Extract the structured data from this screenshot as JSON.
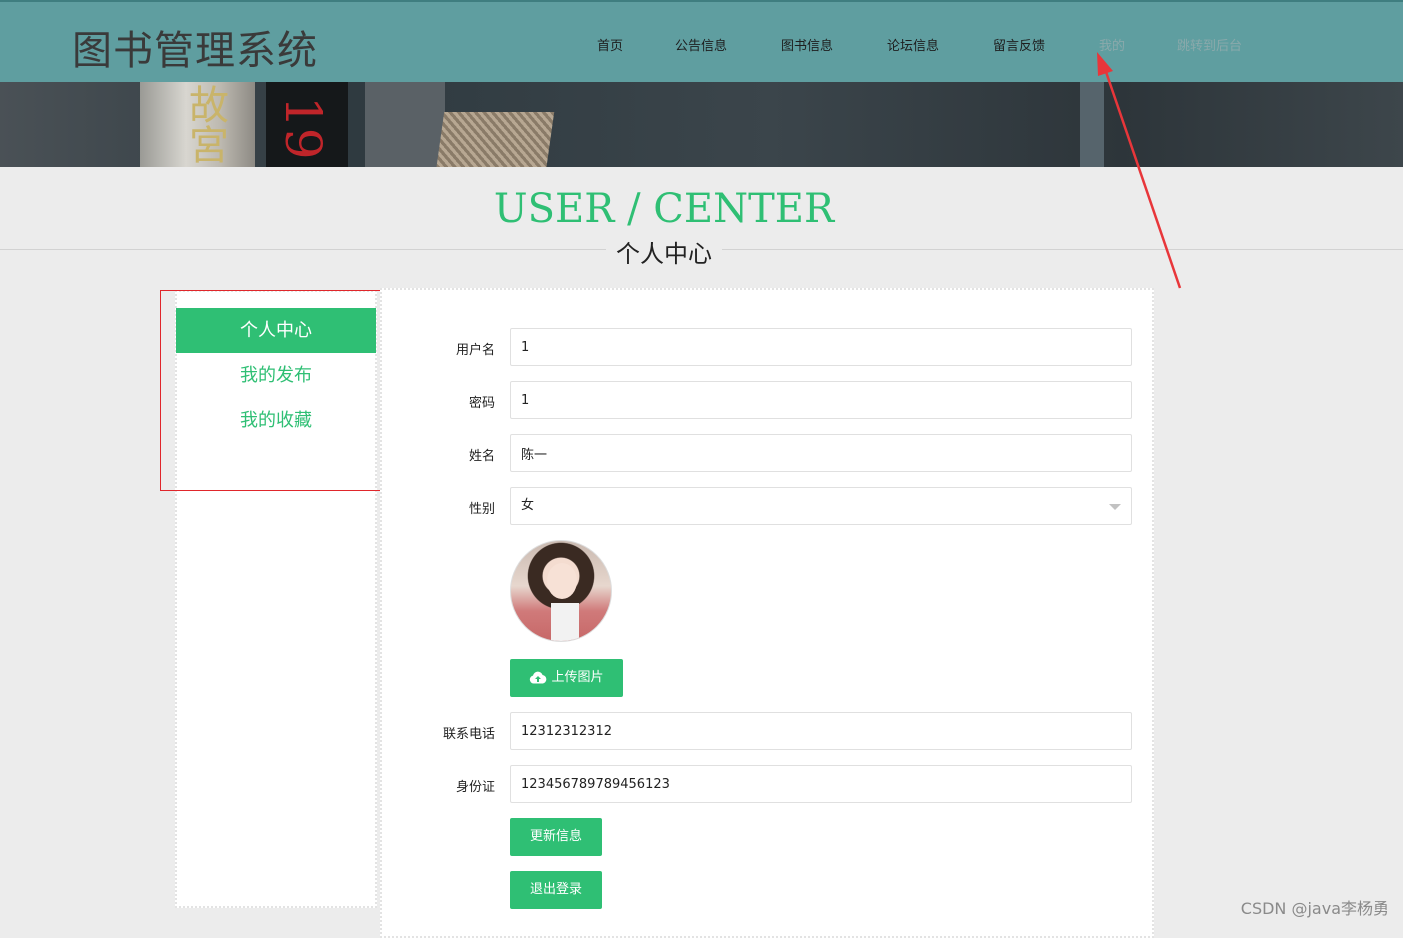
{
  "header": {
    "logo": "图书管理系统",
    "nav": [
      "首页",
      "公告信息",
      "图书信息",
      "论坛信息",
      "留言反馈",
      "我的",
      "跳转到后台"
    ]
  },
  "banner": {
    "book_text_1": "故宮",
    "book_text_2": "19"
  },
  "page": {
    "title_en": "USER / CENTER",
    "title_cn": "个人中心"
  },
  "sidebar": {
    "items": [
      "个人中心",
      "我的发布",
      "我的收藏"
    ],
    "active_index": 0
  },
  "form": {
    "username_label": "用户名",
    "username_value": "1",
    "password_label": "密码",
    "password_value": "1",
    "name_label": "姓名",
    "name_value": "陈一",
    "gender_label": "性别",
    "gender_value": "女",
    "upload_label": "上传图片",
    "phone_label": "联系电话",
    "phone_value": "12312312312",
    "id_label": "身份证",
    "id_value": "123456789789456123",
    "update_label": "更新信息",
    "logout_label": "退出登录"
  },
  "colors": {
    "header": "#5f9ea0",
    "accent": "#2fbf74",
    "annotation": "#e0262b"
  },
  "watermark": "CSDN @java李杨勇"
}
